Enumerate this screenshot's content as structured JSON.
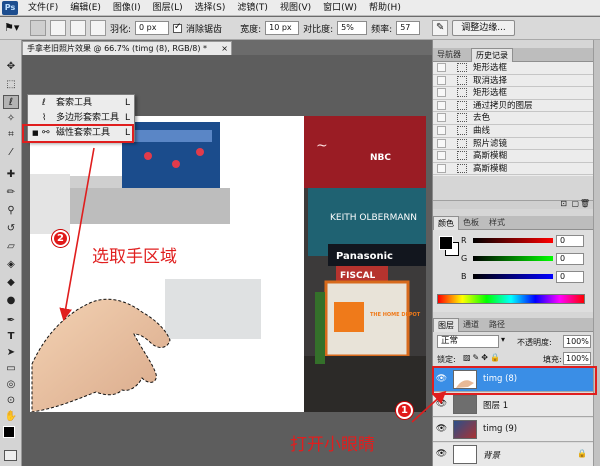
{
  "menu": {
    "logo": "Ps",
    "items": [
      "文件(F)",
      "编辑(E)",
      "图像(I)",
      "图层(L)",
      "选择(S)",
      "滤镜(T)",
      "视图(V)",
      "窗口(W)",
      "帮助(H)"
    ]
  },
  "options": {
    "feather_label": "羽化:",
    "feather_value": "0 px",
    "antialias_label": "消除锯齿",
    "width_label": "宽度:",
    "width_value": "10 px",
    "contrast_label": "对比度:",
    "contrast_value": "5%",
    "frequency_label": "频率:",
    "frequency_value": "57",
    "refine_button": "调整边缘..."
  },
  "document_tab": {
    "title": "手拿老旧照片效果 @ 66.7% (timg (8), RGB/8) *",
    "close": "×"
  },
  "lasso_flyout": {
    "items": [
      {
        "label": "套索工具",
        "key": "L"
      },
      {
        "label": "多边形套索工具",
        "key": "L"
      },
      {
        "label": "磁性套索工具",
        "key": "L",
        "current": true
      }
    ]
  },
  "history_panel": {
    "tabs": [
      "导航器",
      "历史记录"
    ],
    "items": [
      "矩形选框",
      "取消选择",
      "矩形选框",
      "通过拷贝的图层",
      "去色",
      "曲线",
      "照片滤镜",
      "高斯模糊",
      "高斯模糊"
    ]
  },
  "color_panel": {
    "tabs": [
      "颜色",
      "色板",
      "样式"
    ],
    "channels": [
      {
        "name": "R",
        "value": "0"
      },
      {
        "name": "G",
        "value": "0"
      },
      {
        "name": "B",
        "value": "0"
      }
    ]
  },
  "layers_panel": {
    "tabs": [
      "图层",
      "通道",
      "路径"
    ],
    "blend_mode": "正常",
    "opacity_label": "不透明度:",
    "opacity_value": "100%",
    "lock_label": "锁定:",
    "fill_label": "填充:",
    "fill_value": "100%",
    "layers": [
      {
        "name": "timg (8)",
        "selected": true
      },
      {
        "name": "图层 1",
        "selected": false
      },
      {
        "name": "timg (9)",
        "selected": false
      },
      {
        "name": "背景",
        "selected": false,
        "locked": true
      }
    ]
  },
  "canvas_signs": {
    "panasonic": "Panasonic",
    "fiscal": "FISCAL",
    "home_depot": "THE HOME DEPOT",
    "olbermann": "KEITH OLBERMANN",
    "nbc": "NBC"
  },
  "annotations": {
    "step1_number": "1",
    "step1_text": "打开小眼睛",
    "step2_number": "2",
    "step2_text": "选取手区域"
  },
  "colors": {
    "annotation_red": "#e01e1e",
    "selected_layer_blue": "#3a8ee6"
  }
}
